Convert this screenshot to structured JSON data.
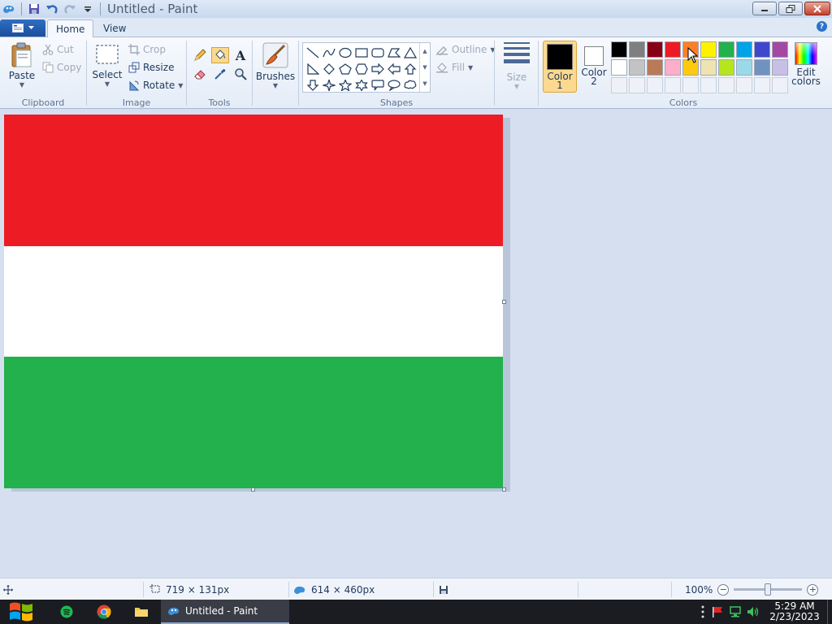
{
  "window": {
    "title": "Untitled - Paint"
  },
  "tabs": [
    {
      "label": "Home",
      "active": true
    },
    {
      "label": "View",
      "active": false
    }
  ],
  "ribbon": {
    "clipboard": {
      "group_label": "Clipboard",
      "paste": "Paste",
      "cut": "Cut",
      "copy": "Copy"
    },
    "image": {
      "group_label": "Image",
      "select": "Select",
      "crop": "Crop",
      "resize": "Resize",
      "rotate": "Rotate"
    },
    "tools": {
      "group_label": "Tools",
      "items": [
        "pencil-icon",
        "fill-bucket-icon",
        "text-icon",
        "eraser-icon",
        "color-picker-icon",
        "magnifier-icon"
      ],
      "selected": "fill-bucket-icon"
    },
    "brushes": {
      "label": "Brushes"
    },
    "shapes": {
      "group_label": "Shapes",
      "outline": "Outline",
      "fill": "Fill",
      "items": [
        "line",
        "curve",
        "oval",
        "rectangle",
        "rounded-rectangle",
        "polygon",
        "triangle",
        "right-triangle",
        "diamond",
        "pentagon",
        "hexagon",
        "right-arrow",
        "left-arrow",
        "up-arrow",
        "down-arrow",
        "four-point-star",
        "five-point-star",
        "six-point-star",
        "rounded-callout",
        "oval-callout",
        "cloud-callout"
      ]
    },
    "size": {
      "label": "Size"
    },
    "colors": {
      "group_label": "Colors",
      "color1_label_line1": "Color",
      "color1_label_line2": "1",
      "color1_value": "#000000",
      "color2_label_line1": "Color",
      "color2_label_line2": "2",
      "color2_value": "#ffffff",
      "edit_colors_line1": "Edit",
      "edit_colors_line2": "colors",
      "palette_row1": [
        "#000000",
        "#7f7f7f",
        "#880015",
        "#ed1c24",
        "#ff7f27",
        "#fff200",
        "#22b14c",
        "#00a2e8",
        "#3f48cc",
        "#a349a4"
      ],
      "palette_row2": [
        "#ffffff",
        "#c3c3c3",
        "#b97a57",
        "#ffaec9",
        "#ffc90e",
        "#efe4b0",
        "#b5e61d",
        "#99d9ea",
        "#7092be",
        "#c8bfe7"
      ]
    }
  },
  "canvas": {
    "stripes": [
      {
        "color": "#ed1c24",
        "fraction": 0.353
      },
      {
        "color": "#ffffff",
        "fraction": 0.295
      },
      {
        "color": "#22b14c",
        "fraction": 0.352
      }
    ]
  },
  "statusbar": {
    "selection_size": "719 × 131px",
    "image_size": "614 × 460px",
    "zoom": "100%"
  },
  "taskbar": {
    "app_label": "Untitled - Paint",
    "time": "5:29 AM",
    "date": "2/23/2023"
  }
}
